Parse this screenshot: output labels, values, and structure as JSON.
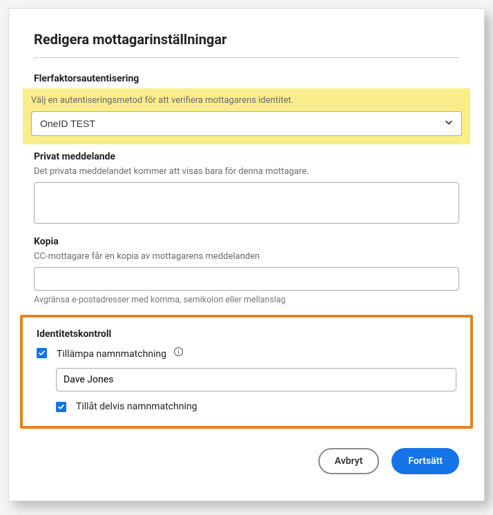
{
  "modal": {
    "title": "Redigera mottagarinställningar"
  },
  "mfa": {
    "label": "Flerfaktorsautentisering",
    "helper": "Välj en autentiseringsmetod för att verifiera mottagarens identitet.",
    "selected": "OneID TEST"
  },
  "privateMessage": {
    "label": "Privat meddelande",
    "helper": "Det privata meddelandet kommer att visas bara för denna mottagare.",
    "value": ""
  },
  "cc": {
    "label": "Kopia",
    "helper": "CC-mottagare får en kopia av mottagarens meddelanden",
    "value": "",
    "hint": "Avgränsa e-postadresser med komma, semikolon eller mellanslag"
  },
  "identity": {
    "label": "Identitetskontroll",
    "applyNameMatch": {
      "checked": true,
      "label": "Tillämpa namnmatchning"
    },
    "nameValue": "Dave Jones",
    "allowPartial": {
      "checked": true,
      "label": "Tillåt delvis namnmatchning"
    }
  },
  "footer": {
    "cancel": "Avbryt",
    "continue": "Fortsätt"
  }
}
